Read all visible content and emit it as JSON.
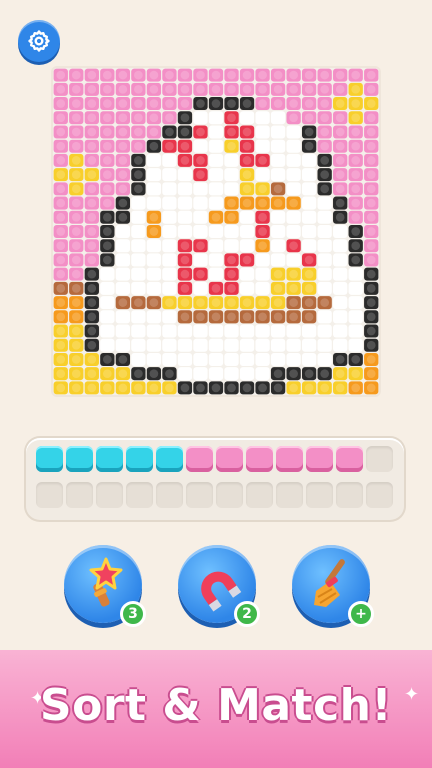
{
  "settings": {
    "icon": "gear-icon"
  },
  "board": {
    "palette": {
      "P": "#f38fc6",
      "K": "#2b2b2b",
      "W": "#ffffff",
      "R": "#e8354b",
      "Y": "#f8cf2b",
      "O": "#f69a1d",
      "B": "#b56a3d"
    },
    "rows": [
      "PPPPPPPPPPPPPPPPPPPPP",
      "PPPPPPPPPPPPPPPPPPPYP",
      "PPPPPPPPPKKKKPPPPPYYY",
      "PPPPPPPPKWWRWWWPPPPYP",
      "PPPPPPPKKRWRRWWWKPPPP",
      "PPPPPPKRRWWYRWWWKPPPP",
      "PYPPPKWWRRWWRRWWWKPPP",
      "YYYPPKWWWRWWYWWWWKPPP",
      "PYPPPKWWWWWWYYBWWKPPP",
      "PPPPKWWWWWWOOOOOWWKPP",
      "PPPKKWOWWWOOWRWWWWKPP",
      "PPPKWWOWWWWWWRWWWWWKP",
      "PPPKWWWWRRWWWOWRWWWKP",
      "PPPKWWWWRWWRRWWWRWWKP",
      "PPKWWWWWRRWRWWYYYWWWK",
      "BBKWWWWWRWRRWWYYYWWWK",
      "OOKWBBBYYYYYYYYBBBWWK",
      "OOKWWWWWBBBBBBBBBWWWK",
      "YYKWWWWWWWWWWWWWWWWWK",
      "YYKWWWWWWWWWWWWWWWWWK",
      "YYYKKWWWWWWWWWWWWWKKO",
      "YYYYYKKKWWWWWWKKKKYYO",
      "YYYYYYYYKKKKKKKYYYYOO"
    ]
  },
  "tray": {
    "top": [
      "cyan",
      "cyan",
      "cyan",
      "cyan",
      "cyan",
      "pink",
      "pink",
      "pink",
      "pink",
      "pink",
      "pink",
      "empty"
    ],
    "bottom": [
      "empty",
      "empty",
      "empty",
      "empty",
      "empty",
      "empty",
      "empty",
      "empty",
      "empty",
      "empty",
      "empty",
      "empty"
    ]
  },
  "boosters": [
    {
      "icon": "magic-wand-icon",
      "count": "3"
    },
    {
      "icon": "magnet-icon",
      "count": "2"
    },
    {
      "icon": "broom-icon",
      "count": "+"
    }
  ],
  "banner": {
    "title": "Sort & Match!"
  }
}
